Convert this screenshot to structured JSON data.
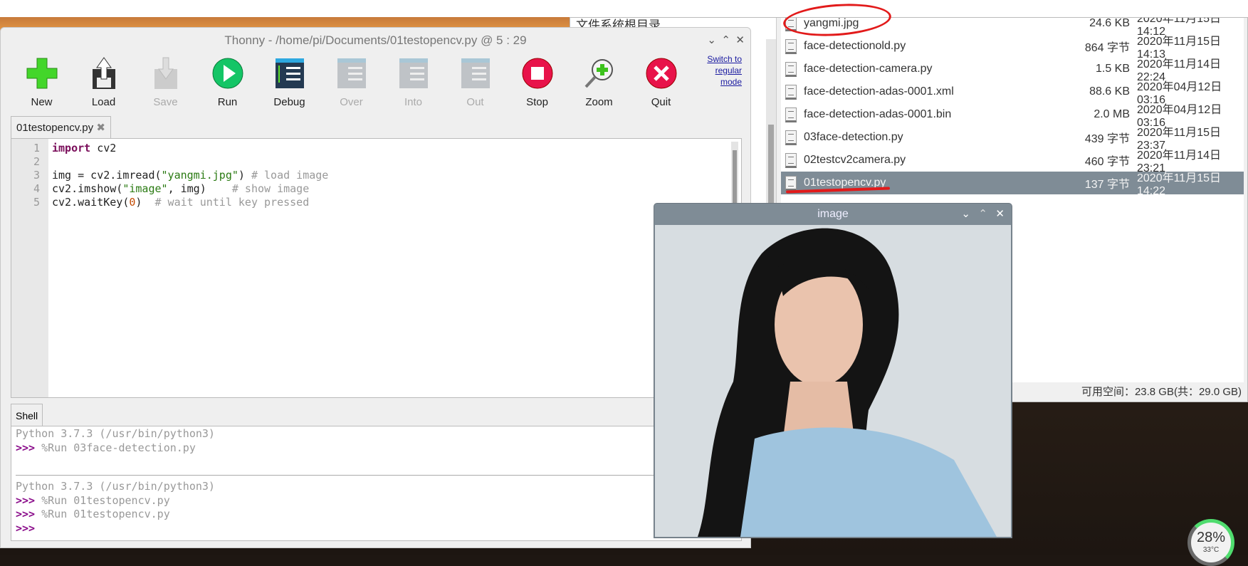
{
  "file_manager": {
    "sidebar_root": "文件系统根目录",
    "files": [
      {
        "name": "yangmi.jpg",
        "size": "24.6 KB",
        "date": "2020年11月15日 14:12",
        "icon": "image-icon"
      },
      {
        "name": "face-detectionold.py",
        "size": "864 字节",
        "date": "2020年11月15日 14:13",
        "icon": "text-file-icon"
      },
      {
        "name": "face-detection-camera.py",
        "size": "1.5 KB",
        "date": "2020年11月14日 22:24",
        "icon": "text-file-icon"
      },
      {
        "name": "face-detection-adas-0001.xml",
        "size": "88.6 KB",
        "date": "2020年04月12日 03:16",
        "icon": "xml-file-icon"
      },
      {
        "name": "face-detection-adas-0001.bin",
        "size": "2.0 MB",
        "date": "2020年04月12日 03:16",
        "icon": "binary-file-icon"
      },
      {
        "name": "03face-detection.py",
        "size": "439 字节",
        "date": "2020年11月15日 23:37",
        "icon": "text-file-icon"
      },
      {
        "name": "02testcv2camera.py",
        "size": "460 字节",
        "date": "2020年11月14日 23:21",
        "icon": "text-file-icon"
      },
      {
        "name": "01testopencv.py",
        "size": "137 字节",
        "date": "2020年11月15日 14:22",
        "icon": "text-file-icon",
        "selected": true
      }
    ],
    "status": "可用空间：23.8 GB(共：29.0 GB)"
  },
  "thonny": {
    "title": "Thonny  -  /home/pi/Documents/01testopencv.py  @  5 : 29",
    "toolbar": [
      {
        "label": "New",
        "enabled": true
      },
      {
        "label": "Load",
        "enabled": true
      },
      {
        "label": "Save",
        "enabled": false
      },
      {
        "label": "Run",
        "enabled": true
      },
      {
        "label": "Debug",
        "enabled": true
      },
      {
        "label": "Over",
        "enabled": false
      },
      {
        "label": "Into",
        "enabled": false
      },
      {
        "label": "Out",
        "enabled": false
      },
      {
        "label": "Stop",
        "enabled": true
      },
      {
        "label": "Zoom",
        "enabled": true
      },
      {
        "label": "Quit",
        "enabled": true
      }
    ],
    "switch_mode": [
      "Switch to",
      "regular",
      "mode"
    ],
    "file_tab": "01testopencv.py",
    "line_numbers": [
      "1",
      "2",
      "3",
      "4",
      "5"
    ],
    "code": {
      "l1a": "import",
      "l1b": " cv2",
      "l3a": "img = cv2.imread(",
      "l3b": "\"yangmi.jpg\"",
      "l3c": ") ",
      "l3d": "# load image",
      "l4a": "cv2.imshow(",
      "l4b": "\"image\"",
      "l4c": ", img)    ",
      "l4d": "# show image",
      "l5a": "cv2.waitKey(",
      "l5b": "0",
      "l5c": ")  ",
      "l5d": "# wait until key pressed"
    },
    "shell_tab": "Shell",
    "shell": {
      "py1": "Python 3.7.3 (/usr/bin/python3)",
      "prompt": ">>>",
      "cmd1": " %Run 03face-detection.py",
      "py2": "Python 3.7.3 (/usr/bin/python3)",
      "cmd2": " %Run 01testopencv.py",
      "cmd3": " %Run 01testopencv.py"
    }
  },
  "image_window": {
    "title": "image"
  },
  "cpu_gauge": {
    "percent": "28%",
    "value": 28,
    "temp": "33°C"
  },
  "colors": {
    "selection": "#7f8c96",
    "annotation": "#e21a1a",
    "keyword": "#7a0d5a",
    "string": "#2a7a12"
  }
}
